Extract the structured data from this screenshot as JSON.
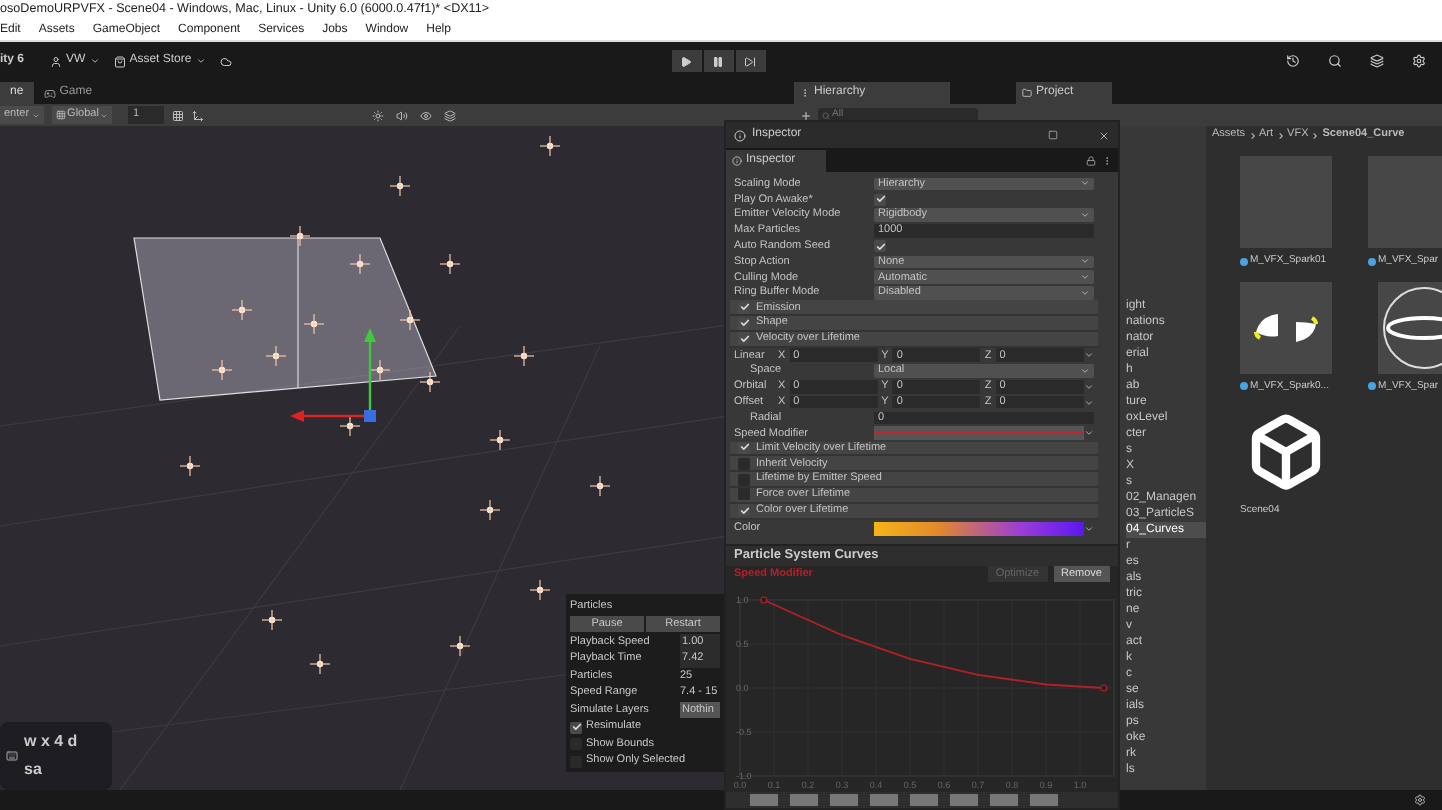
{
  "window": {
    "title": "osoDemoURPVFX - Scene04 - Windows, Mac, Linux - Unity 6.0 (6000.0.47f1)* <DX11>"
  },
  "menu": [
    "Edit",
    "Assets",
    "GameObject",
    "Component",
    "Services",
    "Jobs",
    "Window",
    "Help"
  ],
  "toolbar": {
    "logo": "ity 6",
    "account": "VW",
    "store": "Asset Store"
  },
  "scene_tabs": [
    {
      "label": "ne",
      "selected": true
    },
    {
      "label": "Game",
      "selected": false
    }
  ],
  "scene_toolbar": {
    "pivot": "enter",
    "space": "Global",
    "grid": "1"
  },
  "particles_overlay": {
    "title": "Particles",
    "buttons": [
      "Pause",
      "Restart"
    ],
    "fields": [
      {
        "label": "Playback Speed",
        "value": "1.00",
        "kind": "field"
      },
      {
        "label": "Playback Time",
        "value": "7.42",
        "kind": "field"
      },
      {
        "label": "Particles",
        "value": "25",
        "kind": "text"
      },
      {
        "label": "Speed Range",
        "value": "7.4 - 15",
        "kind": "text"
      },
      {
        "label": "Simulate Layers",
        "value": "Nothin",
        "kind": "dropdown"
      }
    ],
    "toggles": [
      {
        "label": "Resimulate",
        "checked": true
      },
      {
        "label": "Show Bounds",
        "checked": false
      },
      {
        "label": "Show Only Selected",
        "checked": false
      }
    ]
  },
  "key_overlay": {
    "lines": [
      "w x 4 d",
      "sa"
    ]
  },
  "panel_tabs": [
    {
      "label": "Hierarchy"
    },
    {
      "label": "Project"
    }
  ],
  "hierarchy": {
    "placeholder": "All",
    "items": [
      {
        "label": "ight",
        "selected": false
      },
      {
        "label": "nations",
        "selected": false
      },
      {
        "label": "nator",
        "selected": false
      },
      {
        "label": "erial",
        "selected": false
      },
      {
        "label": "h",
        "selected": false
      },
      {
        "label": "ab",
        "selected": false
      },
      {
        "label": "ture",
        "selected": false
      },
      {
        "label": "oxLevel",
        "selected": false
      },
      {
        "label": "cter",
        "selected": false
      },
      {
        "label": "s",
        "selected": false
      },
      {
        "label": "X",
        "selected": false
      },
      {
        "label": "s",
        "selected": false
      },
      {
        "label": "02_Managen",
        "selected": false
      },
      {
        "label": "03_ParticleS",
        "selected": false
      },
      {
        "label": "04_Curves",
        "selected": true
      },
      {
        "label": "r",
        "selected": false
      },
      {
        "label": "es",
        "selected": false
      },
      {
        "label": "als",
        "selected": false
      },
      {
        "label": "tric",
        "selected": false
      },
      {
        "label": "ne",
        "selected": false
      },
      {
        "label": "v",
        "selected": false
      },
      {
        "label": "act",
        "selected": false
      },
      {
        "label": "k",
        "selected": false
      },
      {
        "label": "c",
        "selected": false
      },
      {
        "label": "se",
        "selected": false
      },
      {
        "label": "ials",
        "selected": false
      },
      {
        "label": "ps",
        "selected": false
      },
      {
        "label": "oke",
        "selected": false
      },
      {
        "label": "rk",
        "selected": false
      },
      {
        "label": "ls",
        "selected": false
      }
    ]
  },
  "project": {
    "breadcrumb": [
      "Assets",
      "Art",
      "VFX",
      "Scene04_Curve"
    ],
    "assets": [
      {
        "name": "M_VFX_Spark01",
        "kind": "blank"
      },
      {
        "name": "M_VFX_Spar",
        "kind": "blank"
      },
      {
        "name": "M_VFX_Spark0...",
        "kind": "arcs"
      },
      {
        "name": "M_VFX_Spar",
        "kind": "rings"
      },
      {
        "name": "Scene04",
        "kind": "scene"
      }
    ]
  },
  "inspector": {
    "window_title": "Inspector",
    "tab": "Inspector",
    "rows": [
      {
        "kind": "dropdown",
        "label": "Scaling Mode",
        "value": "Hierarchy"
      },
      {
        "kind": "checkbox",
        "label": "Play On Awake*",
        "checked": true
      },
      {
        "kind": "dropdown",
        "label": "Emitter Velocity Mode",
        "value": "Rigidbody"
      },
      {
        "kind": "text",
        "label": "Max Particles",
        "value": "1000"
      },
      {
        "kind": "checkbox",
        "label": "Auto Random Seed",
        "checked": true
      },
      {
        "kind": "dropdown",
        "label": "Stop Action",
        "value": "None"
      },
      {
        "kind": "dropdown",
        "label": "Culling Mode",
        "value": "Automatic"
      },
      {
        "kind": "dropdown",
        "label": "Ring Buffer Mode",
        "value": "Disabled"
      },
      {
        "kind": "module",
        "label": "Emission",
        "checked": true
      },
      {
        "kind": "module",
        "label": "Shape",
        "checked": true
      },
      {
        "kind": "module",
        "label": "Velocity over Lifetime",
        "checked": true
      },
      {
        "kind": "xyz",
        "label": "Linear",
        "axes": [
          {
            "axis": "X",
            "value": "0"
          },
          {
            "axis": "Y",
            "value": "0"
          },
          {
            "axis": "Z",
            "value": "0"
          }
        ]
      },
      {
        "kind": "dropdown",
        "label": "Space",
        "value": "Local",
        "nested": true
      },
      {
        "kind": "xyz",
        "label": "Orbital",
        "axes": [
          {
            "axis": "X",
            "value": "0"
          },
          {
            "axis": "Y",
            "value": "0"
          },
          {
            "axis": "Z",
            "value": "0"
          }
        ]
      },
      {
        "kind": "xyz",
        "label": "Offset",
        "axes": [
          {
            "axis": "X",
            "value": "0"
          },
          {
            "axis": "Y",
            "value": "0"
          },
          {
            "axis": "Z",
            "value": "0"
          }
        ]
      },
      {
        "kind": "text",
        "label": "Radial",
        "value": "0",
        "nested": true
      },
      {
        "kind": "curve",
        "label": "Speed Modifier"
      },
      {
        "kind": "module",
        "label": "Limit Velocity over Lifetime",
        "checked": true
      },
      {
        "kind": "module",
        "label": "Inherit Velocity",
        "checked": false
      },
      {
        "kind": "module",
        "label": "Lifetime by Emitter Speed",
        "checked": false
      },
      {
        "kind": "module",
        "label": "Force over Lifetime",
        "checked": false
      },
      {
        "kind": "module",
        "label": "Color over Lifetime",
        "checked": true
      },
      {
        "kind": "gradient",
        "label": "Color"
      }
    ],
    "curves": {
      "title": "Particle System Curves",
      "buttons": [
        {
          "label": "Optimize",
          "disabled": true
        },
        {
          "label": "Remove",
          "disabled": false
        }
      ],
      "chart_data": {
        "type": "line",
        "x": [
          0.07,
          0.3,
          0.5,
          0.7,
          0.9,
          1.07
        ],
        "series": [
          {
            "name": "Speed Modifier",
            "color": "#b3202a",
            "values": [
              1,
              0.6,
              0.33,
              0.15,
              0.04,
              0
            ]
          }
        ],
        "xlim": [
          0,
          1.1
        ],
        "ylim": [
          -1,
          1
        ],
        "xticks": [
          {
            "value": 0,
            "label": "0.0"
          },
          {
            "value": 0.1,
            "label": "0.1"
          },
          {
            "value": 0.2,
            "label": "0.2"
          },
          {
            "value": 0.3,
            "label": "0.3"
          },
          {
            "value": 0.4,
            "label": "0.4"
          },
          {
            "value": 0.5,
            "label": "0.5"
          },
          {
            "value": 0.6,
            "label": "0.6"
          },
          {
            "value": 0.7,
            "label": "0.7"
          },
          {
            "value": 0.8,
            "label": "0.8"
          },
          {
            "value": 0.9,
            "label": "0.9"
          },
          {
            "value": 1,
            "label": "1.0"
          }
        ],
        "yticks": [
          {
            "value": 1,
            "label": "1.0"
          },
          {
            "value": 0.5,
            "label": "0.5"
          },
          {
            "value": 0,
            "label": "0.0"
          },
          {
            "value": -0.5,
            "label": "-0.5"
          },
          {
            "value": -1,
            "label": "-1.0"
          }
        ]
      }
    }
  }
}
